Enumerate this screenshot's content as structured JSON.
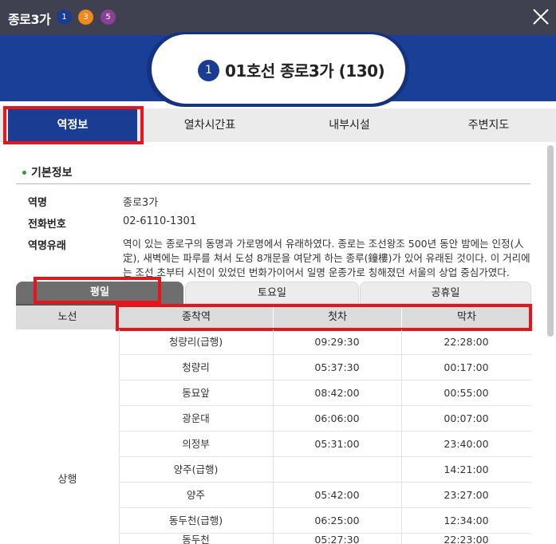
{
  "window": {
    "title": "종로3가",
    "lines": [
      {
        "label": "1",
        "color": "#1a3c93"
      },
      {
        "label": "3",
        "color": "#f08a1c"
      },
      {
        "label": "5",
        "color": "#8b3f95"
      }
    ],
    "close_icon": "close-icon"
  },
  "station": {
    "line_number": "1",
    "name": "01호선 종로3가 (130)"
  },
  "tabs": [
    "역정보",
    "열차시간표",
    "내부시설",
    "주변지도"
  ],
  "active_tab": "역정보",
  "basic_info": {
    "section_title": "기본정보",
    "rows": [
      {
        "label": "역명",
        "value": "종로3가"
      },
      {
        "label": "전화번호",
        "value": "02-6110-1301"
      },
      {
        "label": "역명유래",
        "value": "역이 있는 종로구의 동명과 가로명에서 유래하였다. 종로는 조선왕조 500년 동안 밤에는 인정(人定), 새벽에는 파루를 쳐서 도성 8개문을 여닫게 하는 종루(鐘樓)가 있어 유래된 것이다. 이 거리에는 조선 초부터 시전이 있었던 번화가이어서 일명 운종가로 칭해졌던 서울의 상업 중심가였다."
      }
    ]
  },
  "day_tabs": [
    "평일",
    "토요일",
    "공휴일"
  ],
  "active_day_tab": "평일",
  "timetable": {
    "headers": {
      "line": "노선",
      "terminal": "종착역",
      "first": "첫차",
      "last": "막차"
    },
    "direction": "상행",
    "rows": [
      {
        "terminal": "청량리(급행)",
        "first": "09:29:30",
        "last": "22:28:00"
      },
      {
        "terminal": "청량리",
        "first": "05:37:30",
        "last": "00:17:00"
      },
      {
        "terminal": "동묘앞",
        "first": "08:42:00",
        "last": "00:55:00"
      },
      {
        "terminal": "광운대",
        "first": "06:06:00",
        "last": "00:07:00"
      },
      {
        "terminal": "의정부",
        "first": "05:31:00",
        "last": "23:40:00"
      },
      {
        "terminal": "양주(급행)",
        "first": "",
        "last": "14:21:00"
      },
      {
        "terminal": "양주",
        "first": "05:42:00",
        "last": "23:27:00"
      },
      {
        "terminal": "동두천(급행)",
        "first": "06:25:00",
        "last": "12:34:00"
      },
      {
        "terminal": "동두천",
        "first": "05:27:30",
        "last": "22:23:00"
      }
    ]
  },
  "colors": {
    "topbar": "#3f4150",
    "line1_blue": "#1a3c93",
    "highlight_red": "#e8141c"
  }
}
